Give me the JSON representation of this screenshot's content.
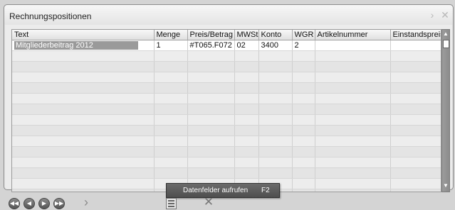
{
  "window": {
    "title": "Rechnungspositionen"
  },
  "grid": {
    "columns": [
      "Text",
      "Menge",
      "Preis/Betrag",
      "MWSt",
      "Konto",
      "WGR",
      "Artikelnummer",
      "Einstandspreis"
    ],
    "rows": [
      [
        "Mitgliederbeitrag 2012",
        "1",
        "#T065.F072",
        "02",
        "3400",
        "2",
        "",
        ""
      ]
    ]
  },
  "context_menu": {
    "label": "Datenfelder aufrufen",
    "shortcut": "F2"
  },
  "icons": {
    "title_next": "chevron-right-icon",
    "title_close": "close-icon",
    "nav_first": "first-icon",
    "nav_prev": "previous-icon",
    "nav_next": "next-icon",
    "nav_last": "last-icon",
    "toolbar_next": "chevron-right-icon",
    "fields": "fields-icon",
    "delete": "delete-icon"
  }
}
